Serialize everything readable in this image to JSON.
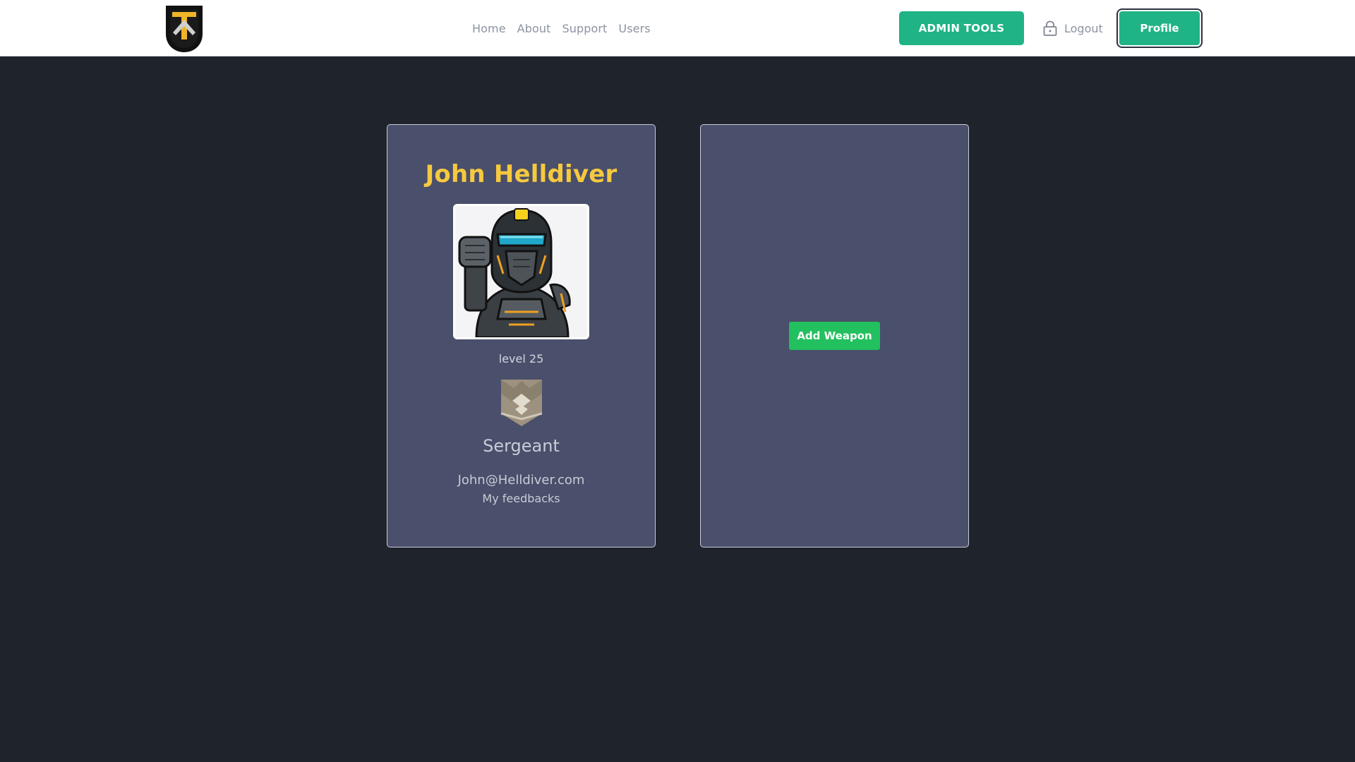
{
  "header": {
    "logo_icon": "shield-arrow-logo-icon",
    "nav": [
      "Home",
      "About",
      "Support",
      "Users"
    ],
    "admin_label": "ADMIN TOOLS",
    "logout_label": "Logout",
    "logout_icon": "lock-icon",
    "profile_label": "Profile"
  },
  "profile": {
    "name": "John Helldiver",
    "avatar_icon": "helldiver-avatar",
    "level": "level 25",
    "rank_icon": "rank-badge-icon",
    "rank": "Sergeant",
    "email": "John@Helldiver.com",
    "feedbacks": "My feedbacks"
  },
  "weapons": {
    "add_label": "Add Weapon"
  },
  "colors": {
    "accent": "#1fb386",
    "add_button": "#22c05e",
    "name": "#f6c93e",
    "card": "#4a4f6b",
    "background": "#1f232c"
  }
}
